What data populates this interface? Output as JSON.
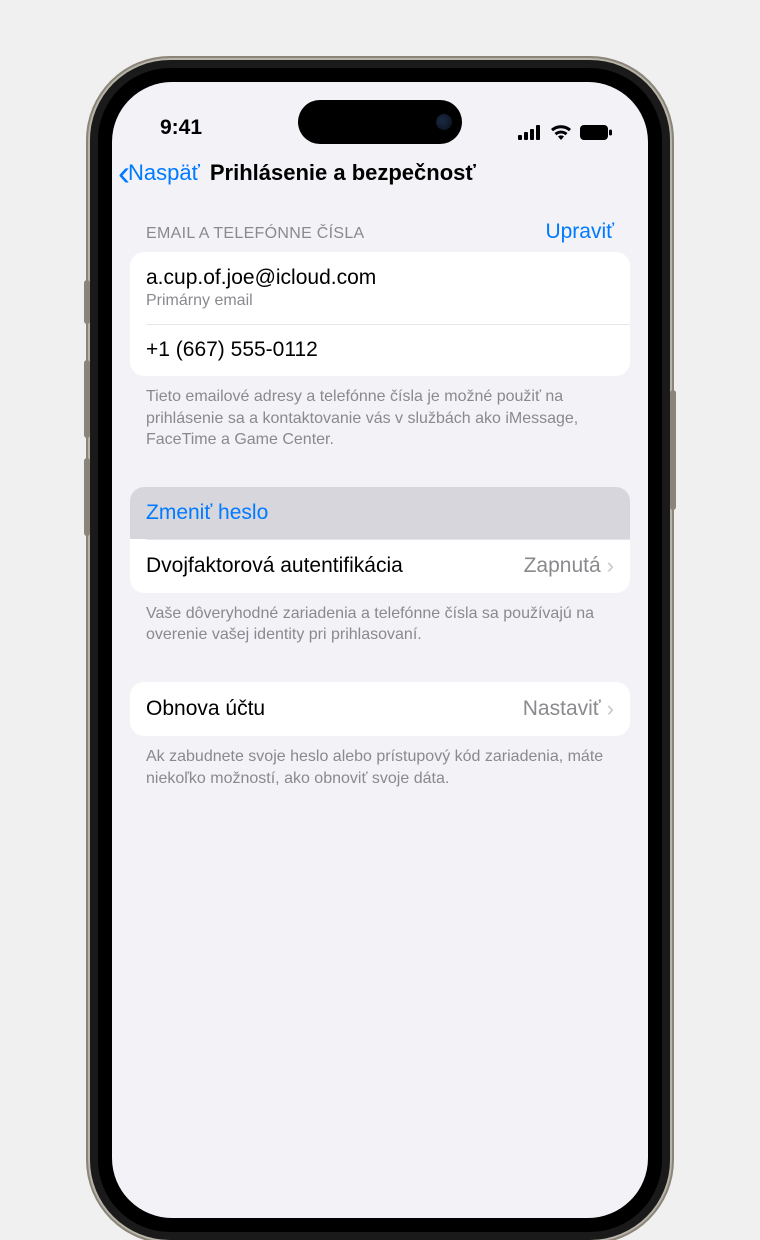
{
  "status": {
    "time": "9:41"
  },
  "nav": {
    "back": "Naspäť",
    "title": "Prihlásenie a bezpečnosť"
  },
  "contacts": {
    "header": "EMAIL A TELEFÓNNE ČÍSLA",
    "edit": "Upraviť",
    "email": "a.cup.of.joe@icloud.com",
    "email_sub": "Primárny email",
    "phone": "+1 (667) 555-0112",
    "footer": "Tieto emailové adresy a telefónne čísla je možné použiť na prihlásenie sa a kontaktovanie vás v službách ako iMessage, FaceTime a Game Center."
  },
  "password": {
    "change": "Zmeniť heslo",
    "twofactor_label": "Dvojfaktorová autentifikácia",
    "twofactor_value": "Zapnutá",
    "footer": "Vaše dôveryhodné zariadenia a telefónne čísla sa používajú na overenie vašej identity pri prihlasovaní."
  },
  "recovery": {
    "label": "Obnova účtu",
    "value": "Nastaviť",
    "footer": "Ak zabudnete svoje heslo alebo prístupový kód zariadenia, máte niekoľko možností, ako obnoviť svoje dáta."
  }
}
